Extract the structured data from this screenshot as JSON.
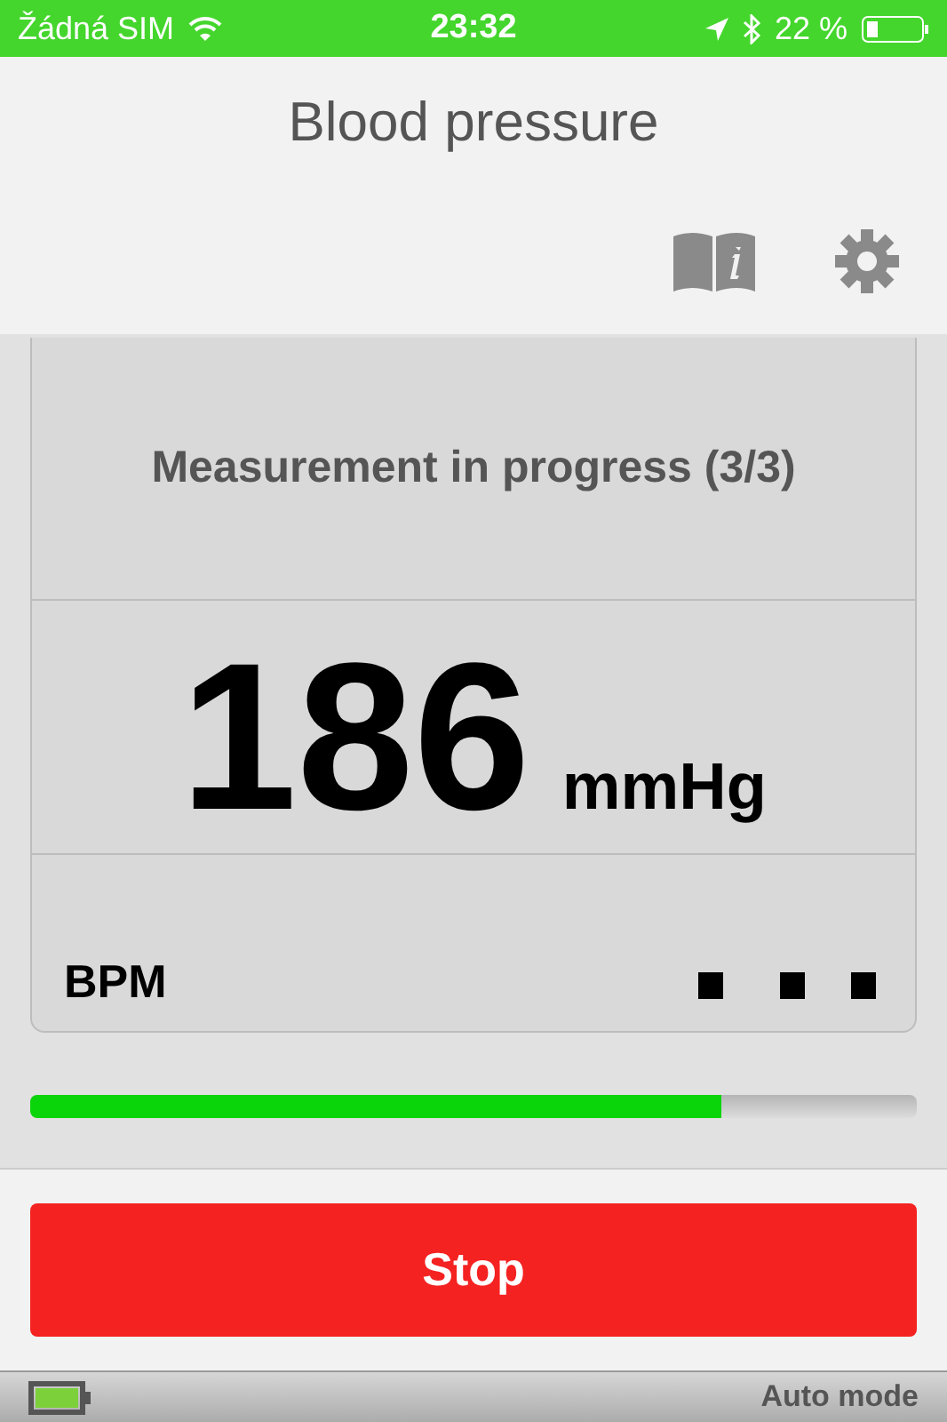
{
  "status_bar": {
    "carrier": "Žádná SIM",
    "time": "23:32",
    "battery": "22 %"
  },
  "title": "Blood pressure",
  "measurement": {
    "status": "Measurement in progress (3/3)",
    "value": "186",
    "unit": "mmHg",
    "pulse_label": "BPM"
  },
  "progress": {
    "level": 0.78
  },
  "stop_button": "Stop",
  "footer": {
    "mode": "Auto mode"
  }
}
